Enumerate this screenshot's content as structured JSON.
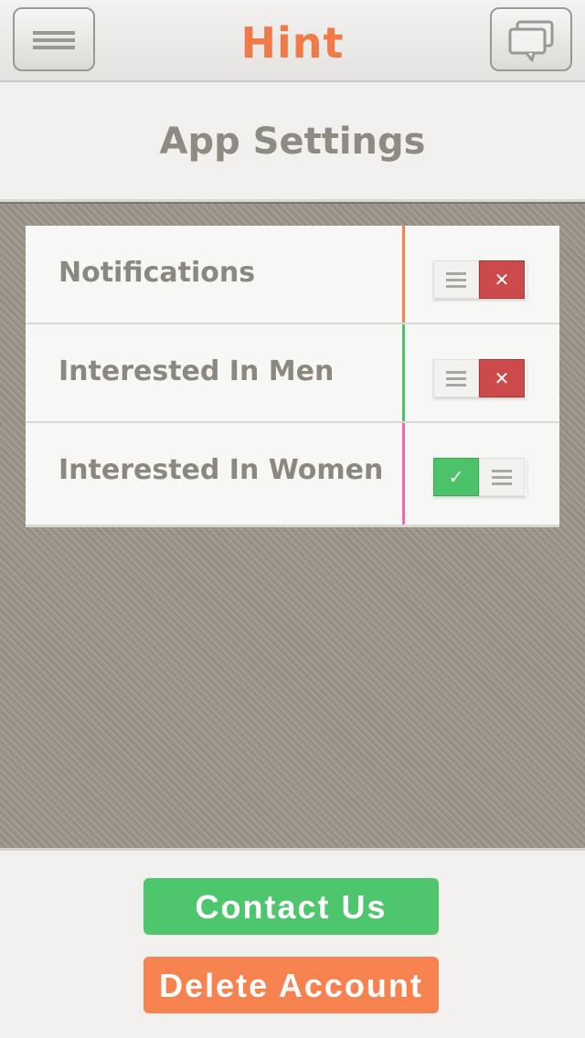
{
  "app": {
    "logo": "Hint"
  },
  "header": {
    "title": "App Settings"
  },
  "settings": [
    {
      "label": "Notifications",
      "state": "off",
      "accent": "#f5814e",
      "icon": "close-icon"
    },
    {
      "label": "Interested In Men",
      "state": "off",
      "accent": "#4cc36a",
      "icon": "close-icon"
    },
    {
      "label": "Interested In Women",
      "state": "on",
      "accent": "#f06aa8",
      "icon": "check-icon"
    }
  ],
  "buttons": {
    "contact": "Contact Us",
    "delete": "Delete Account"
  },
  "colors": {
    "accent_orange": "#f07a48",
    "green": "#4dc66d",
    "red": "#cc4a4a",
    "orange_button": "#f6824f"
  }
}
